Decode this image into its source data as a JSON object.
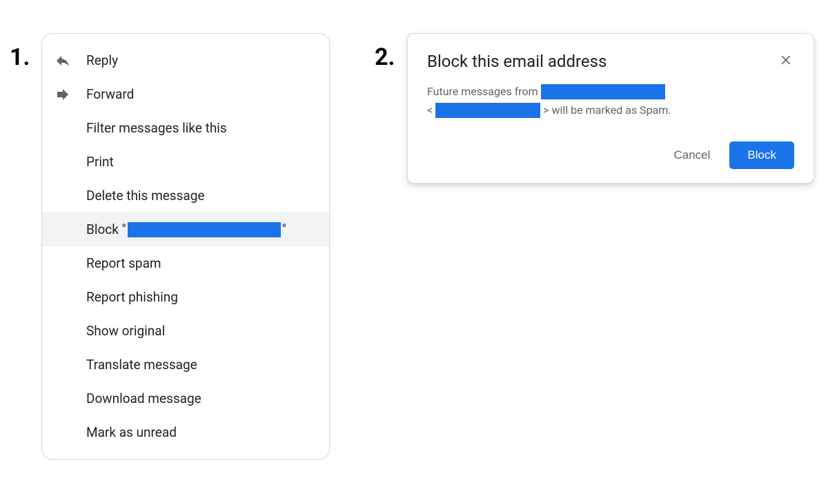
{
  "steps": {
    "one": "1.",
    "two": "2."
  },
  "menu": {
    "items": [
      {
        "icon": "reply-icon",
        "label": "Reply"
      },
      {
        "icon": "forward-icon",
        "label": "Forward"
      },
      {
        "icon": null,
        "label": "Filter messages like this"
      },
      {
        "icon": null,
        "label": "Print"
      },
      {
        "icon": null,
        "label": "Delete this message"
      },
      {
        "icon": null,
        "label_prefix": "Block \"",
        "label_suffix": "\"",
        "redacted": true,
        "hover": true
      },
      {
        "icon": null,
        "label": "Report spam"
      },
      {
        "icon": null,
        "label": "Report phishing"
      },
      {
        "icon": null,
        "label": "Show original"
      },
      {
        "icon": null,
        "label": "Translate message"
      },
      {
        "icon": null,
        "label": "Download message"
      },
      {
        "icon": null,
        "label": "Mark as unread"
      }
    ]
  },
  "dialog": {
    "title": "Block this email address",
    "body_prefix": "Future messages from ",
    "body_angle_open": "<",
    "body_angle_close": ">",
    "body_suffix": " will be marked as Spam.",
    "cancel": "Cancel",
    "confirm": "Block"
  }
}
